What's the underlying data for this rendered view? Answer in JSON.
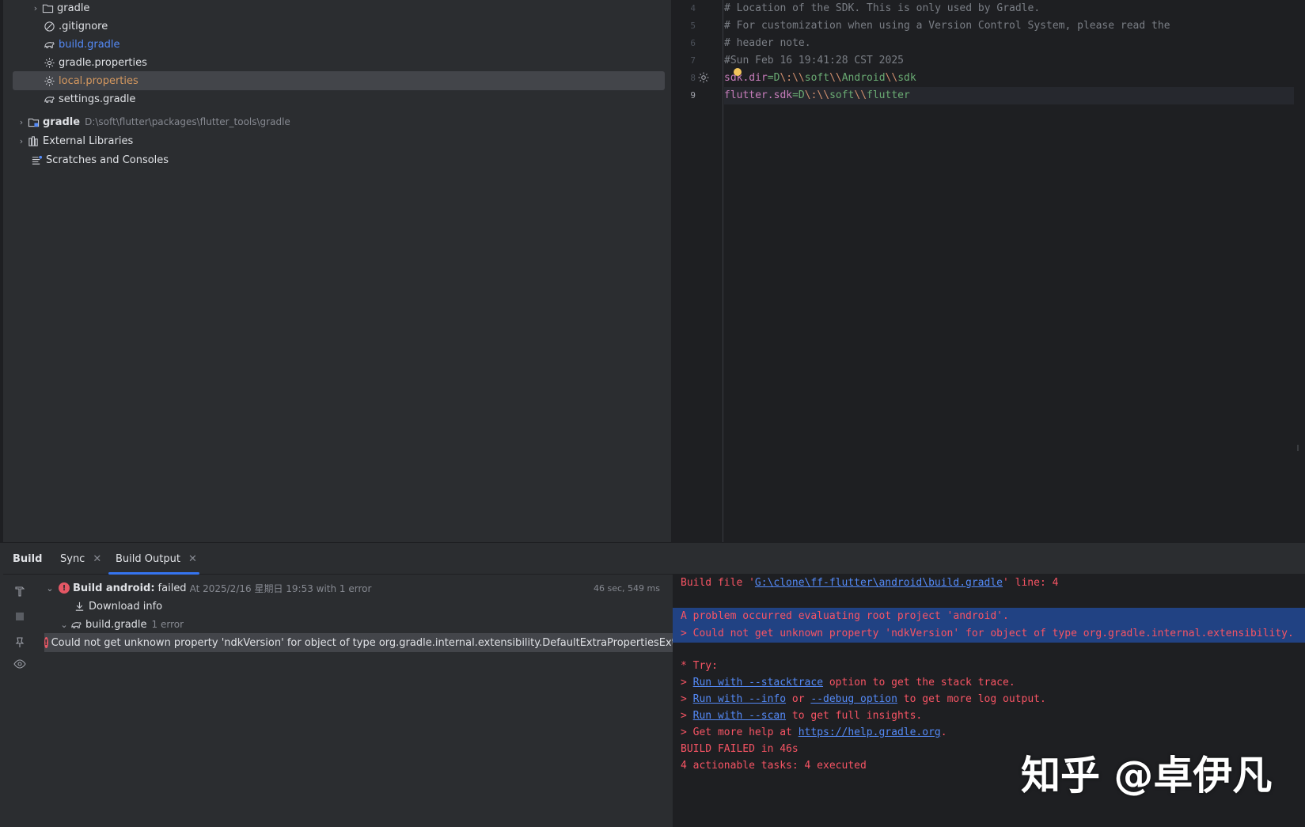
{
  "project_tree": {
    "items": [
      {
        "label": "gradle",
        "kind": "folder",
        "expanded": false
      },
      {
        "label": ".gitignore",
        "kind": "ignore"
      },
      {
        "label": "build.gradle",
        "kind": "gradle"
      },
      {
        "label": "gradle.properties",
        "kind": "properties"
      },
      {
        "label": "local.properties",
        "kind": "properties",
        "selected": true
      },
      {
        "label": "settings.gradle",
        "kind": "gradle"
      },
      {
        "label": "gradle",
        "path": "D:\\soft\\flutter\\packages\\flutter_tools\\gradle",
        "kind": "module",
        "expanded": false
      },
      {
        "label": "External Libraries",
        "kind": "library",
        "expanded": false
      },
      {
        "label": "Scratches and Consoles",
        "kind": "scratches"
      }
    ]
  },
  "editor": {
    "line_numbers": [
      "4",
      "5",
      "6",
      "7",
      "8",
      "9"
    ],
    "lines": [
      "# Location of the SDK. This is only used by Gradle.",
      "# For customization when using a Version Control System, please read the",
      "# header note.",
      "#Sun Feb 16 19:41:28 CST 2025"
    ],
    "prop1": {
      "key": "sdk.dir",
      "eq": "=",
      "parts": [
        "D",
        "\\:",
        "\\\\",
        "soft",
        "\\\\",
        "Android",
        "\\\\",
        "sdk"
      ]
    },
    "prop2": {
      "key": "flutter.sdk",
      "eq": "=",
      "parts": [
        "D",
        "\\:",
        "\\\\",
        "soft",
        "\\\\",
        "flutter"
      ]
    }
  },
  "build_panel": {
    "title": "Build",
    "tabs": [
      "Sync",
      "Build Output"
    ],
    "active_tab": "Build Output",
    "tree": {
      "root_label": "Build android:",
      "root_status": "failed",
      "root_meta": "At 2025/2/16 星期日 19:53 with 1 error",
      "elapsed": "46 sec, 549 ms",
      "download_label": "Download info",
      "file_label": "build.gradle",
      "file_meta": "1 error",
      "error_message": "Could not get unknown property 'ndkVersion' for object of type org.gradle.internal.extensibility.DefaultExtraPropertiesExter"
    },
    "console": {
      "file_prefix": "Build file '",
      "file_link": "G:\\clone\\ff-flutter\\android\\build.gradle",
      "file_suffix": "' line: 4",
      "problem": "A problem occurred evaluating root project 'android'.",
      "detail": "> Could not get unknown property 'ndkVersion' for object of type org.gradle.internal.extensibility.",
      "try": "* Try:",
      "run1_link": "Run with --stacktrace",
      "run1_text": " option to get the stack trace.",
      "run2_link_a": "Run with --info",
      "run2_mid": " or ",
      "run2_link_b": "--debug option",
      "run2_text": " to get more log output.",
      "run3_link": "Run with --scan",
      "run3_text": " to get full insights.",
      "help_prefix": "> Get more help at ",
      "help_link": "https://help.gradle.org",
      "help_suffix": ".",
      "prompt": "> ",
      "failed": "BUILD FAILED in 46s",
      "tasks": "4 actionable tasks: 4 executed"
    }
  },
  "watermark": "知乎 @卓伊凡",
  "colors": {
    "error": "#f75464",
    "link": "#548af7",
    "selection": "#214283",
    "accent": "#3574f0"
  }
}
